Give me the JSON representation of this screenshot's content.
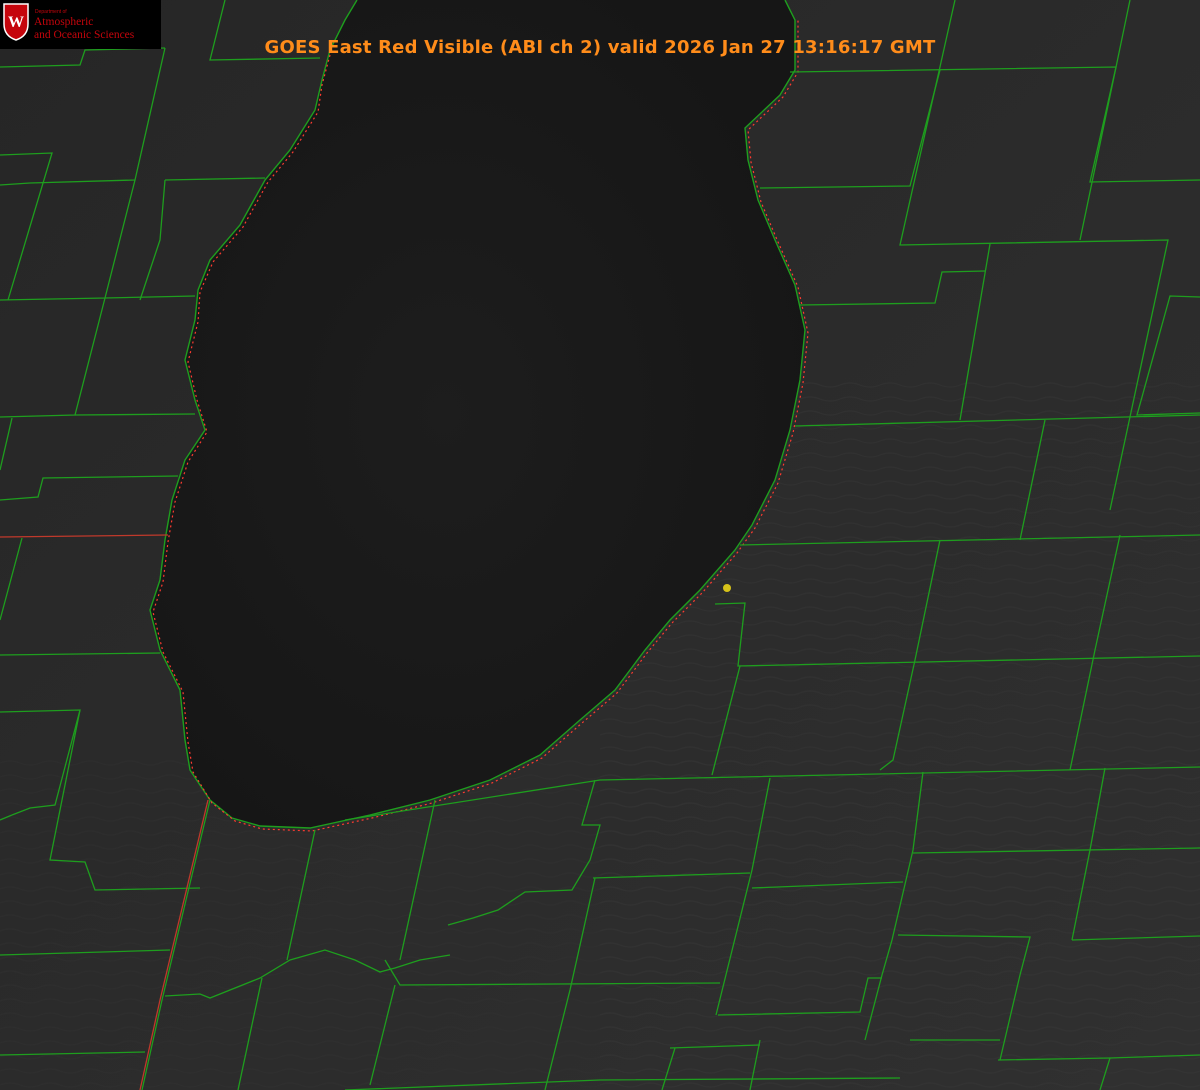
{
  "header": {
    "title": "GOES East Red Visible (ABI ch 2) valid 2026 Jan 27 13:16:17 GMT"
  },
  "logo": {
    "crest_letter": "W",
    "department": "Department of",
    "line1": "Atmospheric",
    "line2": "and Oceanic Sciences"
  },
  "colors": {
    "county_lines": "#1e9e1e",
    "state_line": "#c0392b",
    "shoreline_dots": "#ff3b30",
    "lake": "#181818",
    "land": "#2a2a2a",
    "marker": "#d6c21a",
    "title": "#ff8c1a",
    "logo_red": "#c5050c"
  },
  "map": {
    "feature": "lake",
    "marker": "station-dot"
  }
}
